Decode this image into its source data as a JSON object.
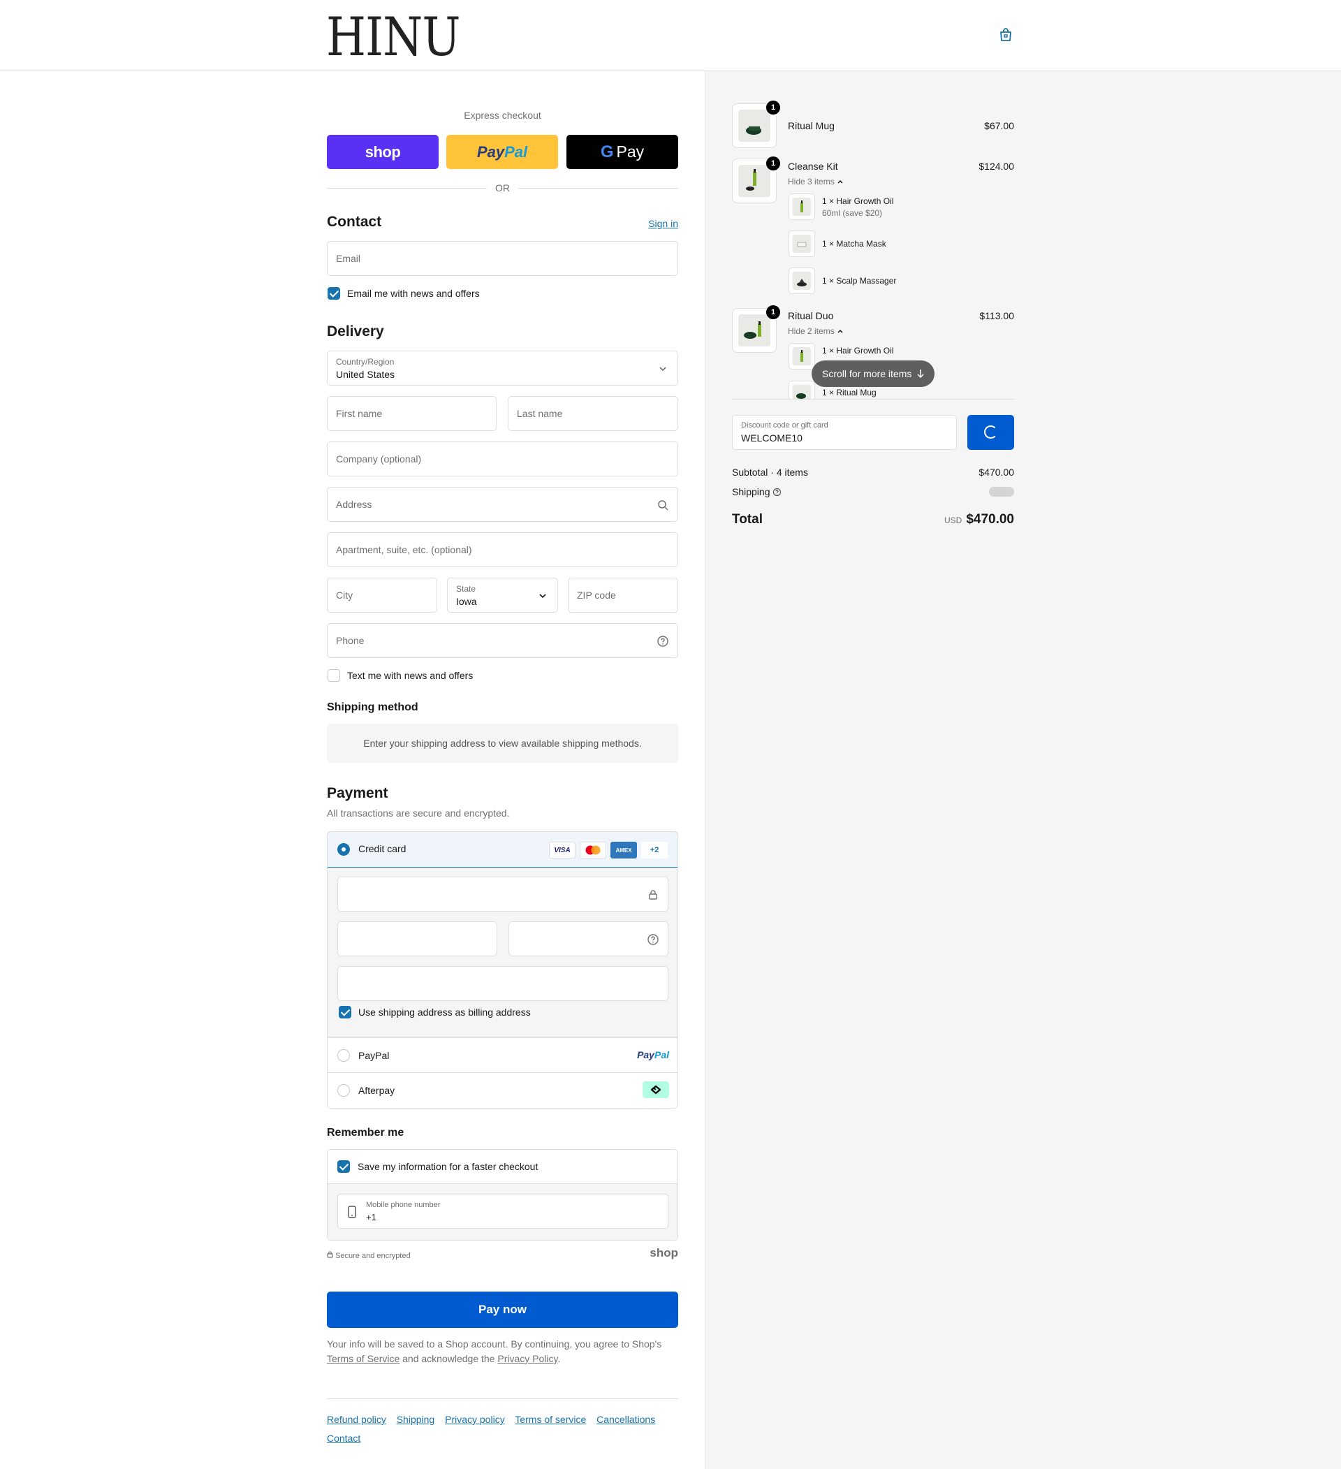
{
  "header": {
    "logo": "HINU"
  },
  "express": {
    "title": "Express checkout",
    "shop_label": "shop",
    "paypal_pay": "Pay",
    "paypal_pal": "Pal",
    "gpay_g": "G",
    "gpay_label": "Pay",
    "or": "OR"
  },
  "contact": {
    "title": "Contact",
    "sign_in": "Sign in",
    "email_placeholder": "Email",
    "news_label": "Email me with news and offers",
    "news_checked": true
  },
  "delivery": {
    "title": "Delivery",
    "country_label": "Country/Region",
    "country_value": "United States",
    "first_name": "First name",
    "last_name": "Last name",
    "company": "Company (optional)",
    "address": "Address",
    "apartment": "Apartment, suite, etc. (optional)",
    "city": "City",
    "state_label": "State",
    "state_value": "Iowa",
    "zip": "ZIP code",
    "phone": "Phone",
    "sms_label": "Text me with news and offers",
    "sms_checked": false
  },
  "shipping_method": {
    "title": "Shipping method",
    "notice": "Enter your shipping address to view available shipping methods."
  },
  "payment": {
    "title": "Payment",
    "subtitle": "All transactions are secure and encrypted.",
    "credit_card": "Credit card",
    "cards": [
      "VISA",
      "",
      "AMEX",
      "+2"
    ],
    "billing_label": "Use shipping address as billing address",
    "billing_checked": true,
    "paypal": "PayPal",
    "paypal_logo_pay": "Pay",
    "paypal_logo_pal": "Pal",
    "afterpay": "Afterpay"
  },
  "remember": {
    "title": "Remember me",
    "save_label": "Save my information for a faster checkout",
    "save_checked": true,
    "phone_label": "Mobile phone number",
    "phone_value": "+1",
    "secure": "Secure and encrypted",
    "shop_logo": "shop"
  },
  "pay_now": "Pay now",
  "legal": {
    "text1": "Your info will be saved to a Shop account. By continuing, you agree to Shop's",
    "tos": "Terms of Service",
    "text2": "and acknowledge the",
    "privacy": "Privacy Policy",
    "end": "."
  },
  "footer": [
    "Refund policy",
    "Shipping",
    "Privacy policy",
    "Terms of service",
    "Cancellations",
    "Contact"
  ],
  "summary": {
    "items": [
      {
        "title": "Ritual Mug",
        "price": "$67.00",
        "qty": "1"
      },
      {
        "title": "Cleanse Kit",
        "price": "$124.00",
        "qty": "1",
        "toggle": "Hide 3 items",
        "subs": [
          {
            "title": "1 × Hair Growth Oil",
            "note": "60ml (save $20)"
          },
          {
            "title": "1 × Matcha Mask"
          },
          {
            "title": "1 × Scalp Massager"
          }
        ]
      },
      {
        "title": "Ritual Duo",
        "price": "$113.00",
        "qty": "1",
        "toggle": "Hide 2 items",
        "subs": [
          {
            "title": "1 × Hair Growth Oil"
          },
          {
            "title": "1 × Ritual Mug"
          }
        ]
      }
    ],
    "scroll_hint": "Scroll for more items",
    "discount_label": "Discount code or gift card",
    "discount_value": "WELCOME10",
    "subtotal_label": "Subtotal · 4 items",
    "subtotal_value": "$470.00",
    "shipping_label": "Shipping",
    "total_label": "Total",
    "total_currency": "USD",
    "total_value": "$470.00"
  },
  "colors": {
    "accent": "#005bd1",
    "link": "#1773b0",
    "shop": "#5a31f4",
    "paypal": "#ffc439"
  }
}
